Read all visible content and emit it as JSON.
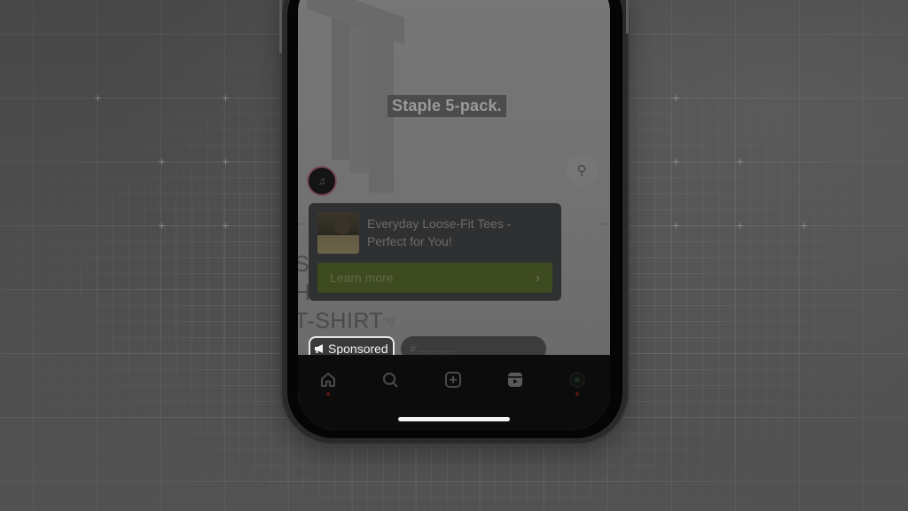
{
  "post": {
    "media_caption": "Staple 5-pack.",
    "background_title": {
      "line1": "S                                  M",
      "line2": "                                  HED",
      "line3": "T-SHIRT"
    },
    "music_hint": "♫ ....ng"
  },
  "ad_card": {
    "title": "Everyday Loose-Fit Tees - Perfect for You!",
    "cta_label": "Learn more",
    "cta_chevron": "›",
    "cta_color": "#3e4a1f"
  },
  "chips": {
    "sponsored_label": "Sponsored",
    "sponsored_icon": "megaphone-icon",
    "hashtag_label": "# ............"
  },
  "icons": {
    "zoom": "⚲",
    "avatar": "♫",
    "arrow_left": "←",
    "arrow_right": "→",
    "heart": "♡",
    "megaphone": "◀"
  },
  "navbar": {
    "items": [
      {
        "name": "home",
        "icon": "home-icon"
      },
      {
        "name": "search",
        "icon": "search-icon"
      },
      {
        "name": "create",
        "icon": "plus-square-icon"
      },
      {
        "name": "reels",
        "icon": "reels-icon"
      },
      {
        "name": "profile",
        "icon": "profile-icon"
      }
    ]
  }
}
